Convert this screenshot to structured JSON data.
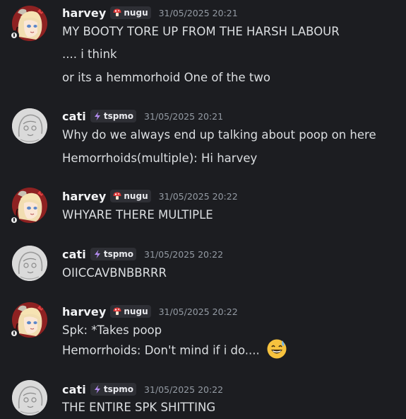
{
  "messages": [
    {
      "username": "harvey",
      "tag": "nugu",
      "tag_icon": "mushroom-icon",
      "timestamp": "31/05/2025 20:21",
      "avatar": "anime-avatar-icon",
      "lines": [
        "MY BOOTY TORE UP FROM THE HARSH LABOUR",
        ".... i think",
        "or its a hemmorhoid One of the two"
      ]
    },
    {
      "username": "cati",
      "tag": "tspmo",
      "tag_icon": "lightning-icon",
      "timestamp": "31/05/2025 20:21",
      "avatar": "sketch-avatar-icon",
      "lines": [
        "Why do we always end up talking about poop on here",
        "Hemorrhoids(multiple): Hi harvey"
      ]
    },
    {
      "username": "harvey",
      "tag": "nugu",
      "tag_icon": "mushroom-icon",
      "timestamp": "31/05/2025 20:22",
      "avatar": "anime-avatar-icon",
      "lines": [
        "WHYARE THERE MULTIPLE"
      ]
    },
    {
      "username": "cati",
      "tag": "tspmo",
      "tag_icon": "lightning-icon",
      "timestamp": "31/05/2025 20:22",
      "avatar": "sketch-avatar-icon",
      "lines": [
        "OIICCAVBNBBRRR"
      ]
    },
    {
      "username": "harvey",
      "tag": "nugu",
      "tag_icon": "mushroom-icon",
      "timestamp": "31/05/2025 20:22",
      "avatar": "anime-avatar-icon",
      "lines": [
        "Spk: *Takes poop",
        "Hemorrhoids: Don't mind if i do...."
      ],
      "trailing_emoji": "sweat-smile-emoji-icon"
    },
    {
      "username": "cati",
      "tag": "tspmo",
      "tag_icon": "lightning-icon",
      "timestamp": "31/05/2025 20:22",
      "avatar": "sketch-avatar-icon",
      "lines": [
        "THE ENTIRE SPK SHITTING"
      ]
    }
  ],
  "colors": {
    "background": "#1c1d21",
    "username": "#f2f3f5",
    "text": "#dbdee1",
    "timestamp": "#949ba4",
    "tag_bg": "#2e2f35"
  }
}
